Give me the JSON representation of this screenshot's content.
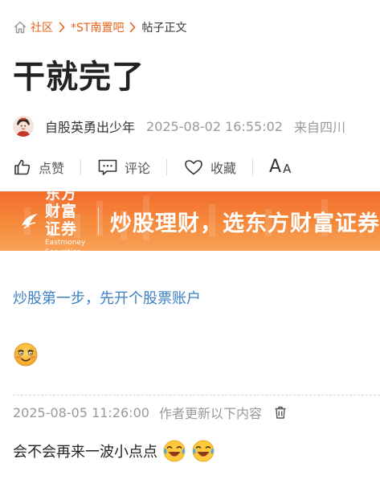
{
  "breadcrumb": {
    "home": "社区",
    "bar": "*ST南置吧",
    "current": "帖子正文"
  },
  "post": {
    "title": "干就完了",
    "author": "自股英勇出少年",
    "time": "2025-08-02 16:55:02",
    "location": "来自四川"
  },
  "actions": {
    "like": "点赞",
    "comment": "评论",
    "collect": "收藏",
    "font_big": "A",
    "font_small": "A"
  },
  "banner": {
    "brand_cn": "东方财富证券",
    "brand_en": "Eastmoney Securities",
    "slogan": "炒股理财，选东方财富证券"
  },
  "content": {
    "link": "炒股第一步，先开个股票账户",
    "emoji": "blush-face-icon"
  },
  "update": {
    "time": "2025-08-05 11:26:00",
    "note": "作者更新以下内容",
    "text": "会不会再来一波小点点"
  },
  "colors": {
    "accent": "#e8631a",
    "link": "#3b7fc4",
    "muted": "#999999",
    "banner": "#f58a3c"
  }
}
